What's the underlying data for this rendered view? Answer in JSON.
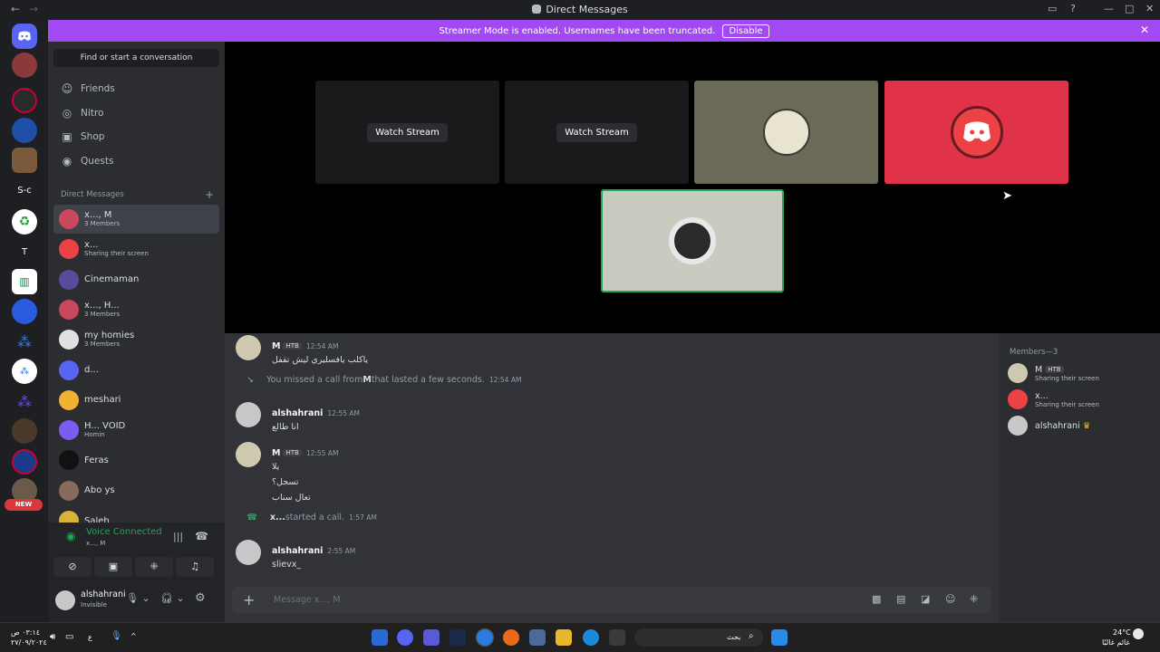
{
  "window": {
    "title": "Direct Messages"
  },
  "banner": {
    "text": "Streamer Mode is enabled. Usernames have been truncated.",
    "button": "Disable"
  },
  "guild_labels": {
    "sc": "S-c",
    "t": "T",
    "new_badge": "NEW"
  },
  "sidebar": {
    "search": "Find or start a conversation",
    "nav": [
      {
        "label": "Friends",
        "icon": "friends-icon"
      },
      {
        "label": "Nitro",
        "icon": "nitro-icon"
      },
      {
        "label": "Shop",
        "icon": "shop-icon"
      },
      {
        "label": "Quests",
        "icon": "quests-icon"
      }
    ],
    "dm_header": "Direct Messages",
    "dms": [
      {
        "name": "x..., M",
        "sub": "3 Members",
        "active": true,
        "color": "#c9485b"
      },
      {
        "name": "x...",
        "sub": "Sharing their screen",
        "active": false,
        "color": "#ed4245"
      },
      {
        "name": "Cinemaman",
        "sub": "",
        "active": false,
        "color": "#5a4a9a"
      },
      {
        "name": "x..., H...",
        "sub": "3 Members",
        "active": false,
        "color": "#c9485b"
      },
      {
        "name": "my homies",
        "sub": "3 Members",
        "active": false,
        "color": "#e0e0e0"
      },
      {
        "name": "d...",
        "sub": "",
        "active": false,
        "color": "#5865f2"
      },
      {
        "name": "meshari",
        "sub": "",
        "active": false,
        "color": "#f0b232"
      },
      {
        "name": "H...  VOID",
        "sub": "Homin",
        "active": false,
        "color": "#7b5cf0"
      },
      {
        "name": "Feras",
        "sub": "",
        "active": false,
        "color": "#111111"
      },
      {
        "name": "Abo ys",
        "sub": "",
        "active": false,
        "color": "#8a6a5a"
      },
      {
        "name": "Saleh",
        "sub": "",
        "active": false,
        "color": "#d8b23a"
      }
    ]
  },
  "voice": {
    "status": "Voice Connected",
    "channel": "x..., M"
  },
  "user": {
    "name": "alshahrani",
    "status": "Invisible"
  },
  "stage": {
    "watch_label": "Watch Stream"
  },
  "messages": [
    {
      "type": "msg",
      "author": "M",
      "tag": "HTB",
      "time": "12:54 AM",
      "lines": [
        "ياكلب يافسليري ليش تقفل"
      ],
      "avatar": "#cfc9b0"
    },
    {
      "type": "sys",
      "pre": "You missed a call from ",
      "who": "M",
      "post": " that lasted a few seconds.",
      "time": "12:54 AM"
    },
    {
      "type": "msg",
      "author": "alshahrani",
      "tag": "",
      "time": "12:55 AM",
      "lines": [
        "انا طالع"
      ],
      "avatar": "#c8c8c8"
    },
    {
      "type": "msg",
      "author": "M",
      "tag": "HTB",
      "time": "12:55 AM",
      "lines": [
        "يلا",
        "تسجل؟",
        "تعال سناب"
      ],
      "avatar": "#cfc9b0"
    },
    {
      "type": "call",
      "who": "x...",
      "post": " started a call.",
      "time": "1:57 AM"
    },
    {
      "type": "msg",
      "author": "alshahrani",
      "tag": "",
      "time": "2:55 AM",
      "lines": [
        "slievx_"
      ],
      "avatar": "#c8c8c8"
    }
  ],
  "composer": {
    "placeholder": "Message x..., M"
  },
  "members": {
    "header": "Members—3",
    "list": [
      {
        "name": "M",
        "tag": "HTB",
        "sub": "Sharing their screen",
        "color": "#cfc9b0"
      },
      {
        "name": "x...",
        "tag": "",
        "sub": "Sharing their screen",
        "color": "#ed4245"
      },
      {
        "name": "alshahrani",
        "tag": "",
        "sub": "",
        "color": "#c8c8c8"
      }
    ]
  },
  "taskbar": {
    "search": "بحث",
    "time": "٠٣:١٤ ص",
    "date": "٢٧/٠٩/٢٠٢٤",
    "lang": "ع",
    "temp": "24°C",
    "weather": "غائم غالبًا"
  }
}
